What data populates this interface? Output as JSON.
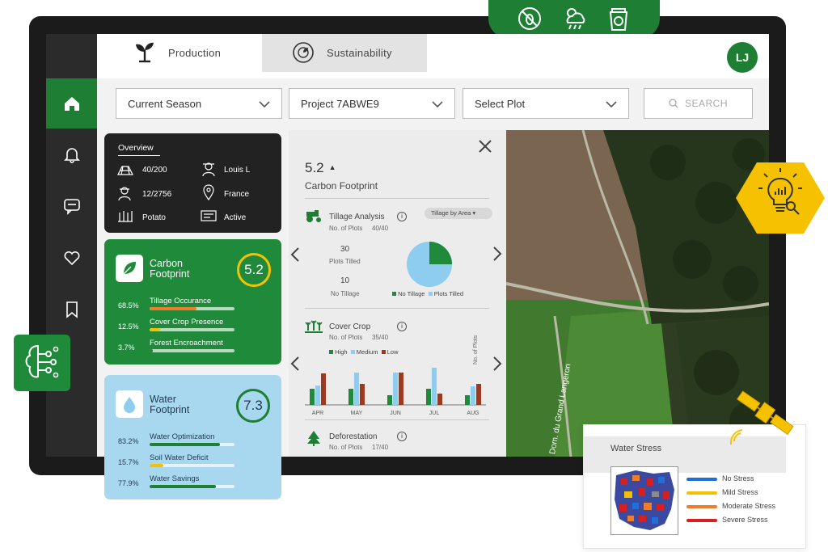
{
  "tabs": [
    {
      "label": "Production",
      "icon": "sprout-icon"
    },
    {
      "label": "Sustainability",
      "icon": "eco-globe-icon"
    }
  ],
  "user": {
    "initials": "LJ"
  },
  "top_badge_icons": [
    "pest-icon",
    "weather-icon",
    "fertilizer-bag-icon"
  ],
  "nav": [
    "home-icon",
    "bell-icon",
    "chat-icon",
    "heart-icon",
    "bookmark-icon"
  ],
  "filters": {
    "season": "Current Season",
    "project": "Project 7ABWE9",
    "plot": "Select Plot",
    "search": "SEARCH"
  },
  "overview": {
    "title": "Overview",
    "items": [
      {
        "icon": "field-icon",
        "value": "40/200"
      },
      {
        "icon": "farmer-icon",
        "value": "Louis L"
      },
      {
        "icon": "worker-icon",
        "value": "12/2756"
      },
      {
        "icon": "location-pin-icon",
        "value": "France"
      },
      {
        "icon": "crop-icon",
        "value": "Potato"
      },
      {
        "icon": "status-list-icon",
        "value": "Active"
      }
    ]
  },
  "carbon_card": {
    "title_line1": "Carbon",
    "title_line2": "Footprint",
    "score": "5.2",
    "metrics": [
      {
        "pct": "68.5%",
        "label": "Tillage Occurance",
        "fill": 0.55,
        "color": "#f07c2c"
      },
      {
        "pct": "12.5%",
        "label": "Cover Crop Presence",
        "fill": 0.12,
        "color": "#f2c200"
      },
      {
        "pct": "3.7%",
        "label": "Forest Encroachment",
        "fill": 0.04,
        "color": "#2e7d32"
      }
    ]
  },
  "water_card": {
    "title_line1": "Water",
    "title_line2": "Footprint",
    "score": "7.3",
    "metrics": [
      {
        "pct": "83.2%",
        "label": "Water Optimization",
        "fill": 0.83,
        "color": "#1e7e34"
      },
      {
        "pct": "15.7%",
        "label": "Soil Water Deficit",
        "fill": 0.16,
        "color": "#f2c200"
      },
      {
        "pct": "77.9%",
        "label": "Water Savings",
        "fill": 0.78,
        "color": "#1e7e34"
      }
    ]
  },
  "detail": {
    "score": "5.2",
    "score_title": "Carbon Footprint",
    "tillage": {
      "title": "Tillage Analysis",
      "sub": "No. of Plots",
      "sub_val": "40/40",
      "dropdown": "Tillage by Area",
      "val_high": "30",
      "lbl_high": "Plots Tilled",
      "val_low": "10",
      "lbl_low": "No Tillage",
      "legend": [
        "No Tillage",
        "Plots Tilled"
      ],
      "pie": {
        "no_tillage": 0.25,
        "plots_tilled": 0.75
      }
    },
    "cover": {
      "title": "Cover Crop",
      "sub": "No. of Plots",
      "sub_val": "35/40",
      "legend": [
        "High",
        "Medium",
        "Low"
      ],
      "ylabel": "No. of Plots",
      "months": [
        "APR",
        "MAY",
        "JUN",
        "JUL",
        "AUG"
      ],
      "high": [
        2,
        2,
        1.2,
        2,
        1.2
      ],
      "medium": [
        2.4,
        4,
        4,
        4.6,
        2.3
      ],
      "low": [
        3.9,
        2.6,
        4,
        1.4,
        2.6
      ]
    },
    "deforest": {
      "title": "Deforestation",
      "sub": "No. of Plots",
      "sub_val": "17/40"
    }
  },
  "map": {
    "road_label": "Dom. du Grand Langeron"
  },
  "water_stress": {
    "title": "Water Stress",
    "legend": [
      {
        "label": "No Stress",
        "color": "#1e6fd9"
      },
      {
        "label": "Mild Stress",
        "color": "#f2c200"
      },
      {
        "label": "Moderate Stress",
        "color": "#f07c2c"
      },
      {
        "label": "Severe Stress",
        "color": "#d62020"
      }
    ]
  },
  "colors": {
    "brand_green": "#1e7e34",
    "accent_yellow": "#f6c200",
    "water_blue": "#a8d8f0"
  }
}
